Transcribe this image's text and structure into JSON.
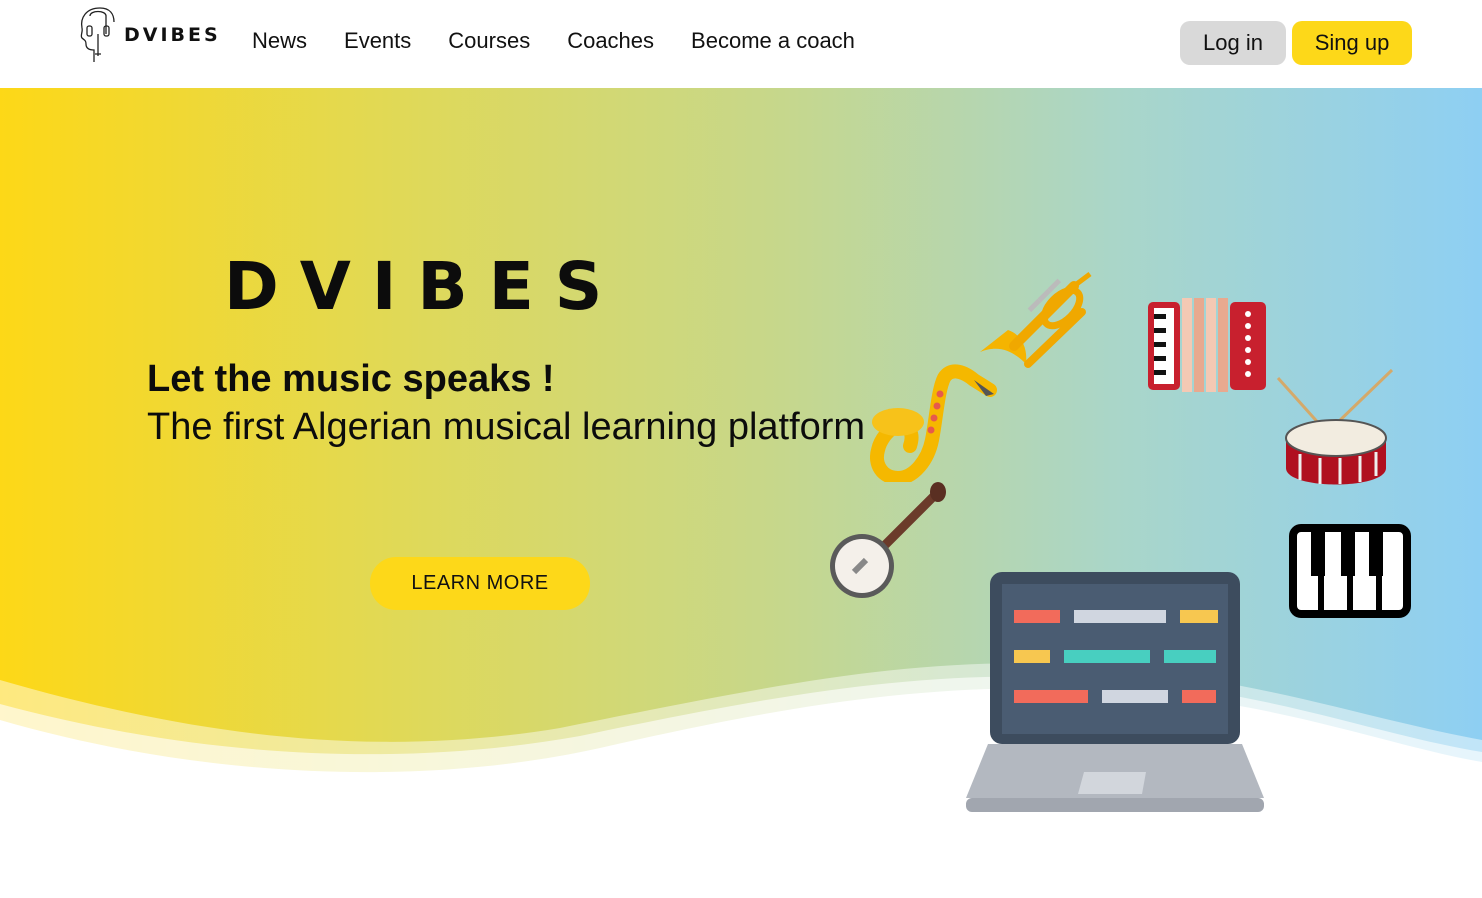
{
  "nav": {
    "logo_text": "DVIBES",
    "links": [
      "News",
      "Events",
      "Courses",
      "Coaches",
      "Become a coach"
    ],
    "login_label": "Log in",
    "signup_label": "Sing up"
  },
  "hero": {
    "brand": "DVIBES",
    "tagline": "Let the music speaks !",
    "subline": "The first Algerian musical learning platform",
    "cta_label": "LEARN MORE"
  },
  "colors": {
    "accent_yellow": "#fdd819",
    "gradient_start": "#fdd817",
    "gradient_end": "#8ecff3",
    "login_bg": "#d9d9d9"
  },
  "icons": [
    "head-logo-icon",
    "saxophone-icon",
    "trumpet-icon",
    "accordion-icon",
    "drum-icon",
    "banjo-icon",
    "piano-keys-icon",
    "laptop-icon"
  ]
}
